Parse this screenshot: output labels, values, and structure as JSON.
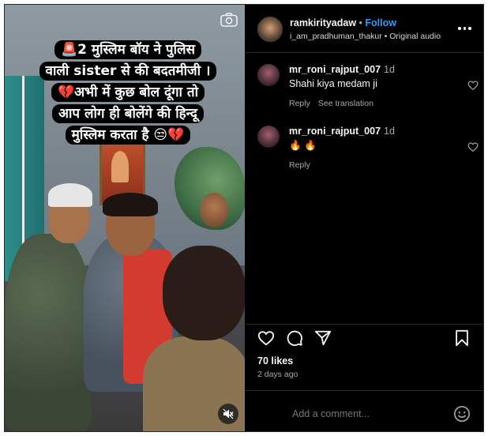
{
  "media": {
    "overlay_lines": [
      "🚨2 मुस्लिम  बॉय ने पुलिस",
      "वाली sister से की बदतमीजी ।",
      "💔अभी  में कुछ बोल दूंगा तो",
      "आप लोग ही बोलेंगे की हिन्दू",
      "मुस्लिम करता है 😒💔"
    ]
  },
  "header": {
    "username": "ramkirityadaw",
    "dot": " • ",
    "follow_label": "Follow",
    "sub_user": "i_am_pradhuman_thakur",
    "sub_dot": " • ",
    "audio": "Original audio"
  },
  "comments": [
    {
      "username": "mr_roni_rajput_007",
      "time": "1d",
      "text": "Shahi kiya medam ji",
      "reply": "Reply",
      "translation": "See translation"
    },
    {
      "username": "mr_roni_rajput_007",
      "time": "1d",
      "text": "🔥 🔥",
      "reply": "Reply"
    }
  ],
  "footer": {
    "likes": "70 likes",
    "date": "2 days ago",
    "add_comment_placeholder": "Add a comment..."
  },
  "icons": {
    "camera": "camera-icon",
    "mute": "muted-speaker-icon",
    "more": "more-options-icon",
    "like": "heart-icon",
    "comment": "comment-bubble-icon",
    "share": "paper-plane-icon",
    "save": "bookmark-icon",
    "emoji": "emoji-smiley-icon"
  },
  "colors": {
    "background": "#000000",
    "accent_link": "#3897f0",
    "muted_text": "#a8a8a8"
  }
}
